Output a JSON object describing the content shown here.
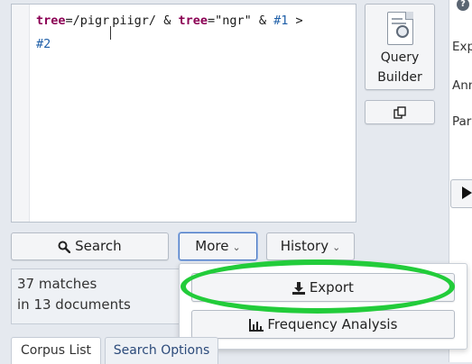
{
  "editor": {
    "line1": [
      {
        "text": "tree",
        "kind": "kw"
      },
      {
        "text": "=/pigr",
        "kind": "tx"
      },
      {
        "text": "|",
        "kind": "cursor"
      },
      {
        "text": "piigr/ & ",
        "kind": "tx"
      },
      {
        "text": "tree",
        "kind": "kw"
      },
      {
        "text": "=\"ngr\" & ",
        "kind": "tx"
      },
      {
        "text": "#1",
        "kind": "ref"
      },
      {
        "text": " >",
        "kind": "tx"
      }
    ],
    "line2": "#2"
  },
  "query_builder": {
    "line1": "Query",
    "line2": "Builder"
  },
  "side_panel": {
    "help": "?",
    "items": [
      "Exp",
      "Ann",
      "Par"
    ]
  },
  "toolbar": {
    "search_label": "Search",
    "more_label": "More",
    "history_label": "History"
  },
  "status": {
    "matches": "37 matches",
    "documents": "in 13 documents"
  },
  "more_menu": {
    "export_label": "Export",
    "frequency_label": "Frequency Analysis"
  },
  "tabs": [
    "Corpus List",
    "Search Options"
  ],
  "colors": {
    "keyword": "#8b0054",
    "reference": "#1f5fa8",
    "highlight": "#22cc3a"
  }
}
